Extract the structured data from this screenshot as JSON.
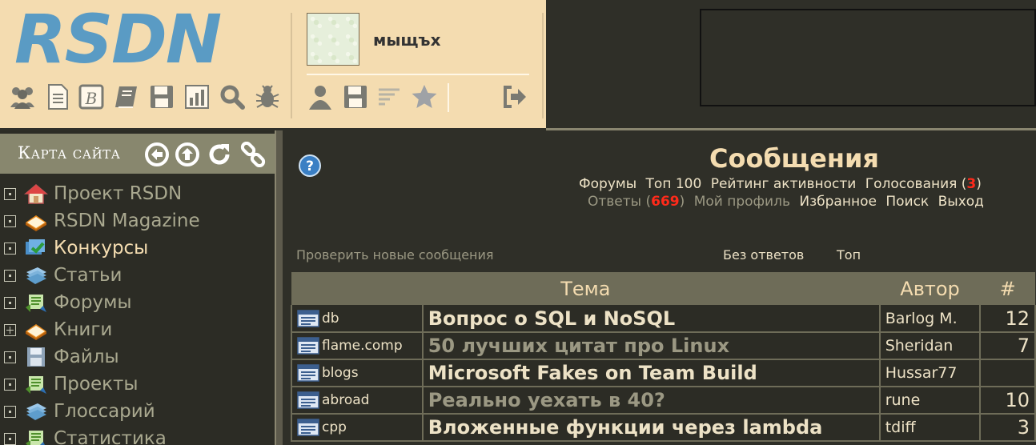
{
  "header": {
    "logo_text": "RSDN",
    "user_name": "мыщъх",
    "toolbar_icons": [
      "users-icon",
      "document-icon",
      "magazine-icon",
      "book-icon",
      "save-icon",
      "chart-icon",
      "search-icon",
      "bug-icon"
    ],
    "user_icons": [
      "user-icon",
      "save-icon",
      "list-icon",
      "star-icon",
      "logout-icon"
    ]
  },
  "sidebar": {
    "title": "Карта сайта",
    "nav_icons": [
      "back-circle-icon",
      "up-circle-icon",
      "refresh-icon",
      "link-icon"
    ],
    "items": [
      {
        "label": "Проект RSDN",
        "icon": "home-icon",
        "expanded": false,
        "active": false
      },
      {
        "label": "RSDN Magazine",
        "icon": "book-open-icon",
        "expanded": false,
        "active": false
      },
      {
        "label": "Конкурсы",
        "icon": "contest-icon",
        "expanded": false,
        "active": true
      },
      {
        "label": "Статьи",
        "icon": "articles-icon",
        "expanded": false,
        "active": false
      },
      {
        "label": "Форумы",
        "icon": "forum-icon",
        "expanded": false,
        "active": false
      },
      {
        "label": "Книги",
        "icon": "book-open-icon",
        "expanded": true,
        "active": false
      },
      {
        "label": "Файлы",
        "icon": "floppy-icon",
        "expanded": false,
        "active": false
      },
      {
        "label": "Проекты",
        "icon": "forum-icon",
        "expanded": false,
        "active": false
      },
      {
        "label": "Глоссарий",
        "icon": "articles-icon",
        "expanded": false,
        "active": false
      },
      {
        "label": "Статистика",
        "icon": "forum-icon",
        "expanded": false,
        "active": false
      }
    ]
  },
  "main": {
    "title": "Сообщения",
    "menu_row1": {
      "forums": "Форумы",
      "top100": "Топ 100",
      "rating": "Рейтинг активности",
      "votes": "Голосования",
      "votes_open": " (",
      "votes_count": "3",
      "votes_close": ")"
    },
    "menu_row2": {
      "answers": "Ответы",
      "answers_open": " (",
      "answers_count": "669",
      "answers_close": ")",
      "profile": "Мой профиль",
      "favorites": "Избранное",
      "search": "Поиск",
      "exit": "Выход"
    },
    "check_new": "Проверить новые сообщения",
    "no_answers": "Без ответов",
    "top": "Топ"
  },
  "table": {
    "headers": {
      "topic": "Тема",
      "author": "Автор",
      "count": "#"
    },
    "rows": [
      {
        "forum": "db",
        "topic": "Вопрос о SQL и NoSQL",
        "read": false,
        "author": "Barlog M.",
        "count": "12"
      },
      {
        "forum": "flame.comp",
        "topic": "50 лучших цитат про Linux",
        "read": true,
        "author": "Sheridan",
        "count": "7"
      },
      {
        "forum": "blogs",
        "topic": "Microsoft Fakes on Team Build",
        "read": false,
        "author": "Hussar77",
        "count": ""
      },
      {
        "forum": "abroad",
        "topic": "Реально уехать в 40?",
        "read": true,
        "author": "rune",
        "count": "10"
      },
      {
        "forum": "cpp",
        "topic": "Вложенные функции через lambda",
        "read": false,
        "author": "tdiff",
        "count": "3"
      }
    ]
  },
  "colors": {
    "header_bg": "#f4dcb0",
    "page_bg": "#2f2f28",
    "logo": "#5a9bc4",
    "accent_red": "#ff2a1a",
    "table_header": "#6e6c58"
  }
}
